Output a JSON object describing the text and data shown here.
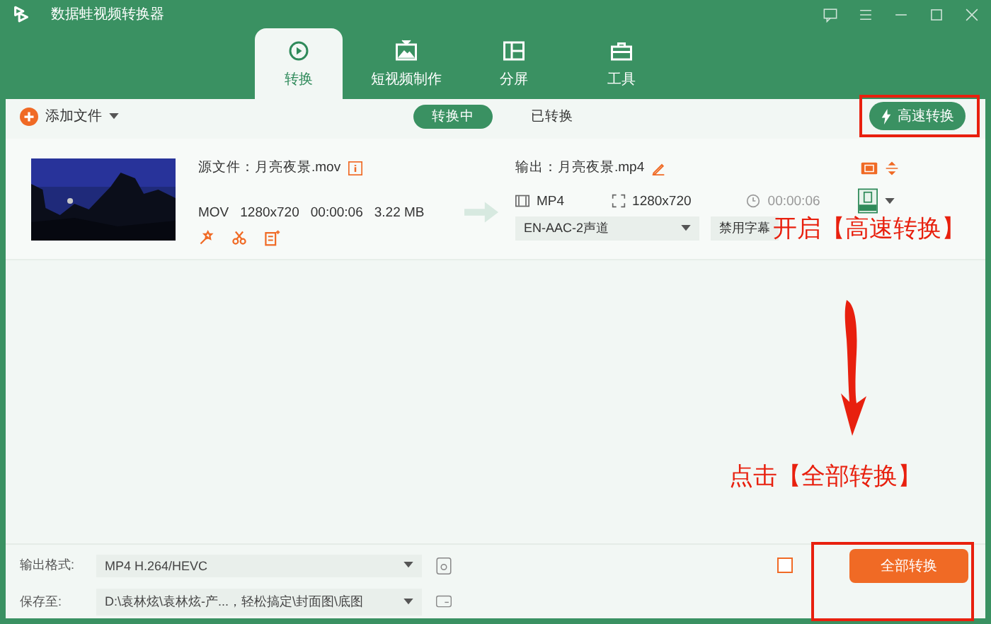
{
  "window": {
    "title": "数据蛙视频转换器"
  },
  "tabs": [
    {
      "label": "转换",
      "selected": true
    },
    {
      "label": "短视频制作",
      "selected": false
    },
    {
      "label": "分屏",
      "selected": false
    },
    {
      "label": "工具",
      "selected": false
    }
  ],
  "toolbar": {
    "add_file": "添加文件",
    "filters": [
      {
        "label": "转换中",
        "selected": true
      },
      {
        "label": "已转换",
        "selected": false
      }
    ],
    "speed_button": "高速转换"
  },
  "file": {
    "source_label": "源文件：月亮夜景.mov",
    "source_meta": [
      "MOV",
      "1280x720",
      "00:00:06",
      "3.22 MB"
    ],
    "output_label": "输出：月亮夜景.mp4",
    "output_format": "MP4",
    "output_resolution": "1280x720",
    "output_duration": "00:00:06",
    "audio_track": "EN-AAC-2声道",
    "subtitle": "禁用字幕"
  },
  "bottom": {
    "format_label": "输出格式:",
    "format_value": "MP4 H.264/HEVC",
    "save_label": "保存至:",
    "save_value": "D:\\袁林炫\\袁林炫-产...，轻松搞定\\封面图\\底图",
    "merge_checked": false,
    "convert_all": "全部转换"
  },
  "annotations": [
    {
      "text": "开启【高速转换】"
    },
    {
      "text": "点击【全部转换】"
    }
  ]
}
